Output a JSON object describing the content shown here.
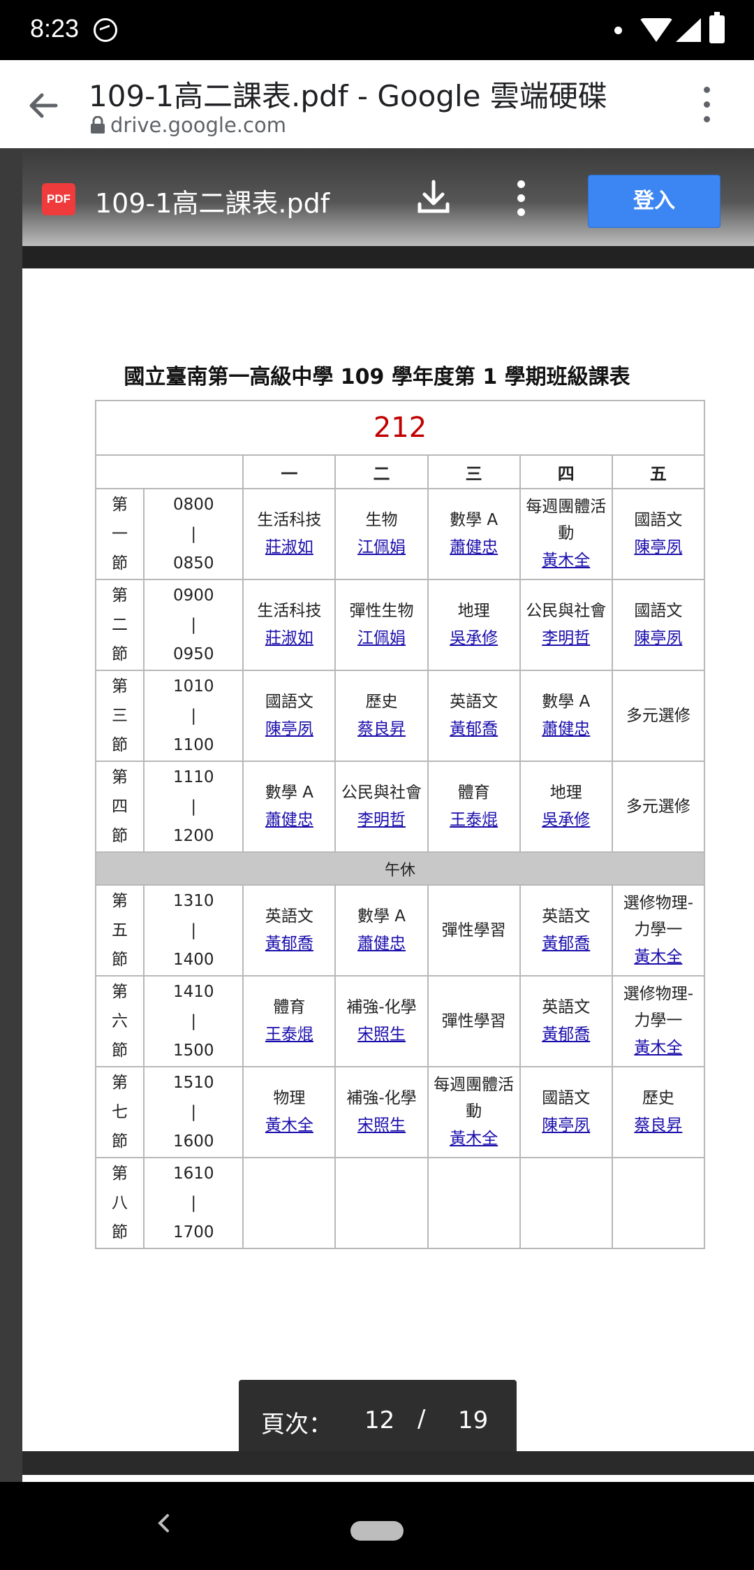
{
  "status_bar": {
    "time": "8:23"
  },
  "browser": {
    "title": "109-1高二課表.pdf - Google 雲端硬碟",
    "domain": "drive.google.com"
  },
  "viewer": {
    "badge": "PDF",
    "file_name": "109-1高二課表.pdf",
    "login_label": "登入"
  },
  "document": {
    "title": "國立臺南第一高級中學 109 學年度第 1 學期班級課表",
    "class_number": "212",
    "days": [
      "一",
      "二",
      "三",
      "四",
      "五"
    ],
    "lunch_label": "午休",
    "periods": [
      {
        "label": [
          "第",
          "一",
          "節"
        ],
        "time": [
          "0800",
          "|",
          "0850"
        ],
        "cells": [
          {
            "subject": "生活科技",
            "teacher": "莊淑如"
          },
          {
            "subject": "生物",
            "teacher": "江佩娟"
          },
          {
            "subject": "數學 A",
            "teacher": "蕭健忠"
          },
          {
            "subject": "每週團體活",
            "subject2": "動",
            "teacher": "黃木全"
          },
          {
            "subject": "國語文",
            "teacher": "陳亭夙"
          }
        ]
      },
      {
        "label": [
          "第",
          "二",
          "節"
        ],
        "time": [
          "0900",
          "|",
          "0950"
        ],
        "cells": [
          {
            "subject": "生活科技",
            "teacher": "莊淑如"
          },
          {
            "subject": "彈性生物",
            "teacher": "江佩娟"
          },
          {
            "subject": "地理",
            "teacher": "吳承修"
          },
          {
            "subject": "公民與社會",
            "teacher": "李明哲"
          },
          {
            "subject": "國語文",
            "teacher": "陳亭夙"
          }
        ]
      },
      {
        "label": [
          "第",
          "三",
          "節"
        ],
        "time": [
          "1010",
          "|",
          "1100"
        ],
        "cells": [
          {
            "subject": "國語文",
            "teacher": "陳亭夙"
          },
          {
            "subject": "歷史",
            "teacher": "蔡良昇"
          },
          {
            "subject": "英語文",
            "teacher": "黃郁喬"
          },
          {
            "subject": "數學 A",
            "teacher": "蕭健忠"
          },
          {
            "subject": "多元選修"
          }
        ]
      },
      {
        "label": [
          "第",
          "四",
          "節"
        ],
        "time": [
          "1110",
          "|",
          "1200"
        ],
        "cells": [
          {
            "subject": "數學 A",
            "teacher": "蕭健忠"
          },
          {
            "subject": "公民與社會",
            "teacher": "李明哲"
          },
          {
            "subject": "體育",
            "teacher": "王泰焜"
          },
          {
            "subject": "地理",
            "teacher": "吳承修"
          },
          {
            "subject": "多元選修"
          }
        ]
      },
      {
        "label": [
          "第",
          "五",
          "節"
        ],
        "time": [
          "1310",
          "|",
          "1400"
        ],
        "cells": [
          {
            "subject": "英語文",
            "teacher": "黃郁喬"
          },
          {
            "subject": "數學 A",
            "teacher": "蕭健忠"
          },
          {
            "subject": "彈性學習"
          },
          {
            "subject": "英語文",
            "teacher": "黃郁喬"
          },
          {
            "subject": "選修物理-",
            "subject2": "力學一",
            "teacher": "黃木全"
          }
        ]
      },
      {
        "label": [
          "第",
          "六",
          "節"
        ],
        "time": [
          "1410",
          "|",
          "1500"
        ],
        "cells": [
          {
            "subject": "體育",
            "teacher": "王泰焜"
          },
          {
            "subject": "補強-化學",
            "teacher": "宋照生"
          },
          {
            "subject": "彈性學習"
          },
          {
            "subject": "英語文",
            "teacher": "黃郁喬"
          },
          {
            "subject": "選修物理-",
            "subject2": "力學一",
            "teacher": "黃木全"
          }
        ]
      },
      {
        "label": [
          "第",
          "七",
          "節"
        ],
        "time": [
          "1510",
          "|",
          "1600"
        ],
        "cells": [
          {
            "subject": "物理",
            "teacher": "黃木全"
          },
          {
            "subject": "補強-化學",
            "teacher": "宋照生"
          },
          {
            "subject": "每週團體活",
            "subject2": "動",
            "teacher": "黃木全"
          },
          {
            "subject": "國語文",
            "teacher": "陳亭夙"
          },
          {
            "subject": "歷史",
            "teacher": "蔡良昇"
          }
        ]
      },
      {
        "label": [
          "第",
          "八",
          "節"
        ],
        "time": [
          "1610",
          "|",
          "1700"
        ],
        "cells": [
          {},
          {},
          {},
          {},
          {}
        ]
      }
    ]
  },
  "page_nav": {
    "label": "頁次：",
    "current": "12",
    "separator": "/",
    "total": "19"
  }
}
